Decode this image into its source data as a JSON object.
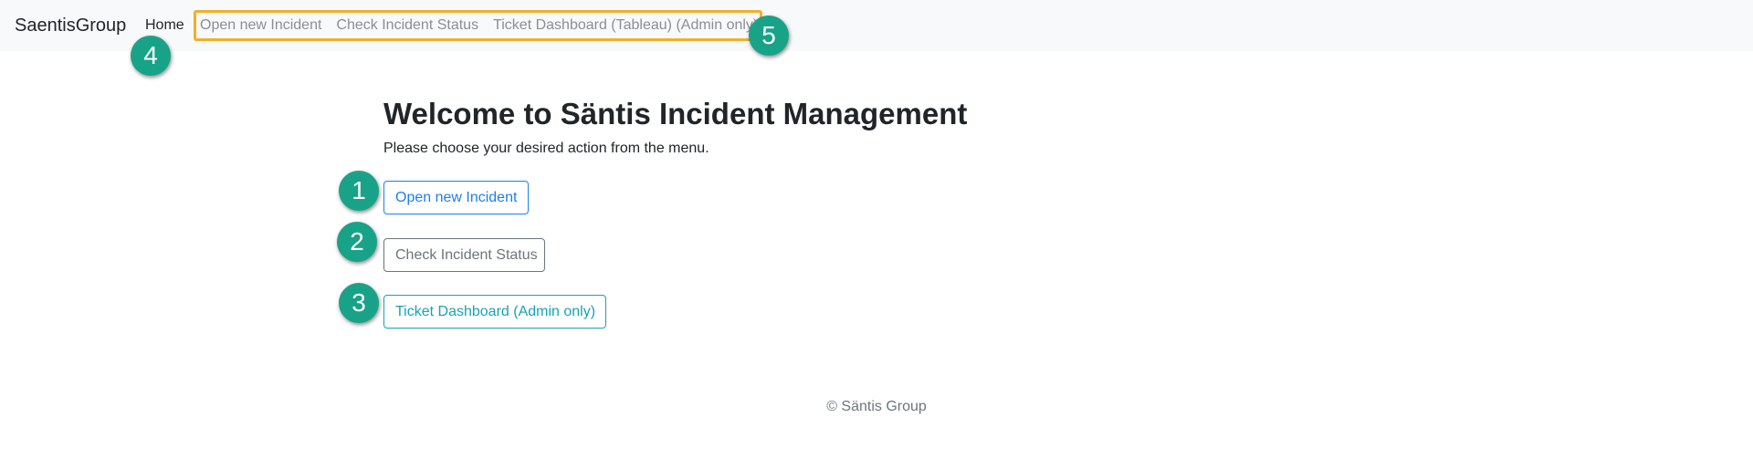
{
  "navbar": {
    "brand": "SaentisGroup",
    "home": "Home",
    "links": [
      {
        "label": "Open new Incident"
      },
      {
        "label": "Check Incident Status"
      },
      {
        "label": "Ticket Dashboard (Tableau) (Admin only)"
      }
    ]
  },
  "main": {
    "title": "Welcome to Säntis Incident Management",
    "subtitle": "Please choose your desired action from the menu.",
    "buttons": [
      {
        "label": "Open new Incident",
        "color": "#1b7ff0"
      },
      {
        "label": "Check Incident Status",
        "color": "#6c757d"
      },
      {
        "label": "Ticket Dashboard (Admin only)",
        "color": "#17a2b8"
      }
    ]
  },
  "annotations": {
    "badges": [
      "1",
      "2",
      "3",
      "4",
      "5"
    ],
    "badge_color": "#18a388",
    "highlight_color": "#f0b02b"
  },
  "footer": {
    "text": "© Säntis Group"
  }
}
